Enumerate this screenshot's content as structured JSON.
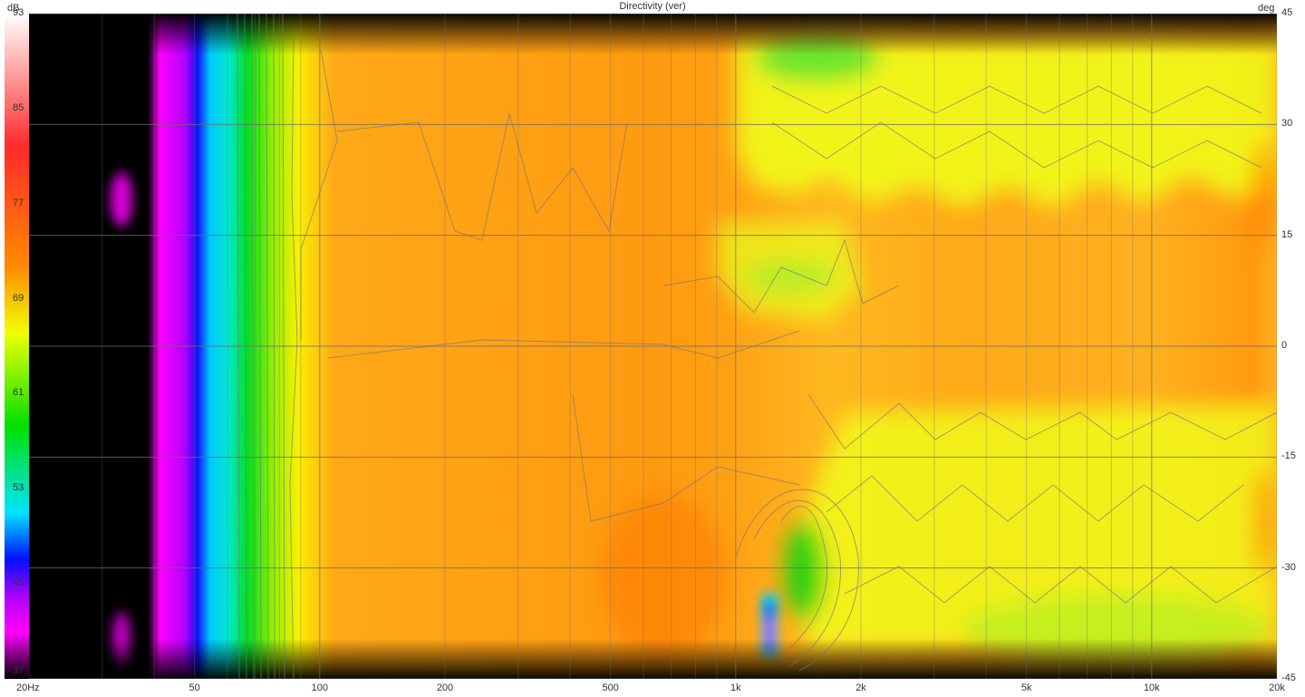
{
  "chart_data": {
    "type": "heatmap",
    "title": "Directivity (ver)",
    "colorbar": {
      "unit": "dB",
      "ticks": [
        93,
        85,
        77,
        69,
        61,
        53,
        45,
        37
      ],
      "range": [
        37,
        93
      ]
    },
    "x_axis": {
      "scale": "log",
      "range_hz": [
        20,
        20000
      ],
      "ticks": [
        {
          "value": 20,
          "label": "20Hz"
        },
        {
          "value": 50,
          "label": "50"
        },
        {
          "value": 100,
          "label": "100"
        },
        {
          "value": 200,
          "label": "200"
        },
        {
          "value": 500,
          "label": "500"
        },
        {
          "value": 1000,
          "label": "1k"
        },
        {
          "value": 2000,
          "label": "2k"
        },
        {
          "value": 5000,
          "label": "5k"
        },
        {
          "value": 10000,
          "label": "10k"
        },
        {
          "value": 20000,
          "label": "20k"
        }
      ]
    },
    "y_axis": {
      "unit": "deg",
      "range": [
        -45,
        45
      ],
      "ticks": [
        45,
        30,
        15,
        0,
        -15,
        -30,
        -45
      ]
    },
    "grid": true,
    "colors": {
      "orange": "#ff9a10",
      "yellow": "#f4ff10",
      "green": "#10e010",
      "cyan": "#10e5ff",
      "blue": "#1010ff",
      "magenta": "#ff10ff",
      "black": "#000000",
      "grid": "#7a7a7a"
    }
  }
}
